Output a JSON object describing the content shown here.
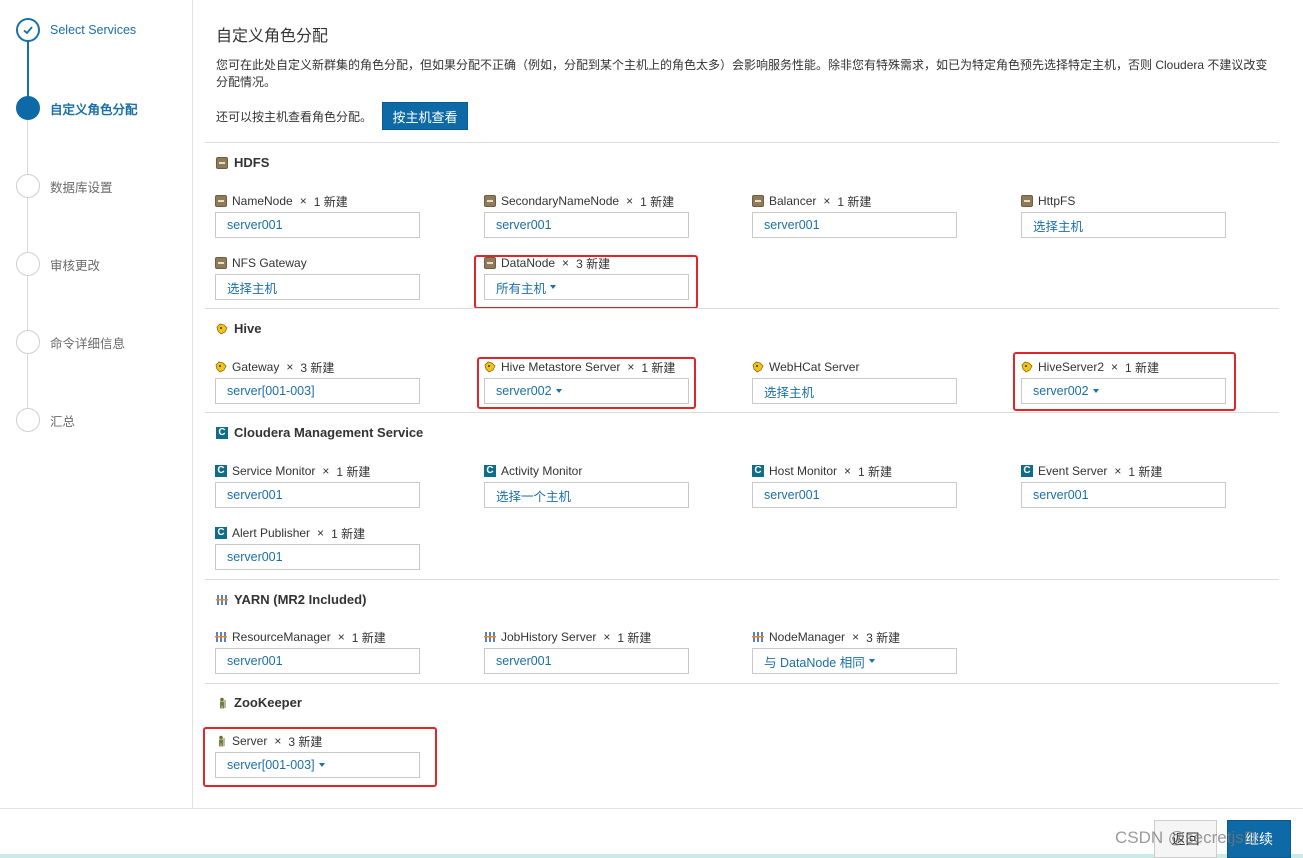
{
  "wizard": {
    "steps": [
      {
        "label": "Select Services",
        "state": "done"
      },
      {
        "label": "自定义角色分配",
        "state": "active"
      },
      {
        "label": "数据库设置",
        "state": "todo"
      },
      {
        "label": "审核更改",
        "state": "todo"
      },
      {
        "label": "命令详细信息",
        "state": "todo"
      },
      {
        "label": "汇总",
        "state": "todo"
      }
    ]
  },
  "page": {
    "title": "自定义角色分配",
    "description": "您可在此处自定义新群集的角色分配，但如果分配不正确（例如，分配到某个主机上的角色太多）会影响服务性能。除非您有特殊需求，如已为特定角色预先选择特定主机，否则 Cloudera 不建议改变分配情况。",
    "host_view_text": "还可以按主机查看角色分配。",
    "host_view_button": "按主机查看"
  },
  "services": {
    "hdfs": {
      "name": "HDFS",
      "roles": [
        {
          "name": "NameNode",
          "x": "×",
          "count": "1 新建",
          "value": "server001"
        },
        {
          "name": "SecondaryNameNode",
          "x": "×",
          "count": "1 新建",
          "value": "server001"
        },
        {
          "name": "Balancer",
          "x": "×",
          "count": "1 新建",
          "value": "server001"
        },
        {
          "name": "HttpFS",
          "x": "",
          "count": "",
          "value": "选择主机"
        },
        {
          "name": "NFS Gateway",
          "x": "",
          "count": "",
          "value": "选择主机"
        },
        {
          "name": "DataNode",
          "x": "×",
          "count": "3 新建",
          "value": "所有主机"
        }
      ]
    },
    "hive": {
      "name": "Hive",
      "roles": [
        {
          "name": "Gateway",
          "x": "×",
          "count": "3 新建",
          "value": "server[001-003]"
        },
        {
          "name": "Hive Metastore Server",
          "x": "×",
          "count": "1 新建",
          "value": "server002"
        },
        {
          "name": "WebHCat Server",
          "x": "",
          "count": "",
          "value": "选择主机"
        },
        {
          "name": "HiveServer2",
          "x": "×",
          "count": "1 新建",
          "value": "server002"
        }
      ]
    },
    "cms": {
      "name": "Cloudera Management Service",
      "icon_letter": "C",
      "roles": [
        {
          "name": "Service Monitor",
          "x": "×",
          "count": "1 新建",
          "value": "server001"
        },
        {
          "name": "Activity Monitor",
          "x": "",
          "count": "",
          "value": "选择一个主机"
        },
        {
          "name": "Host Monitor",
          "x": "×",
          "count": "1 新建",
          "value": "server001"
        },
        {
          "name": "Event Server",
          "x": "×",
          "count": "1 新建",
          "value": "server001"
        },
        {
          "name": "Alert Publisher",
          "x": "×",
          "count": "1 新建",
          "value": "server001"
        }
      ]
    },
    "yarn": {
      "name": "YARN (MR2 Included)",
      "roles": [
        {
          "name": "ResourceManager",
          "x": "×",
          "count": "1 新建",
          "value": "server001"
        },
        {
          "name": "JobHistory Server",
          "x": "×",
          "count": "1 新建",
          "value": "server001"
        },
        {
          "name": "NodeManager",
          "x": "×",
          "count": "3 新建",
          "value": "与 DataNode 相同"
        }
      ]
    },
    "zookeeper": {
      "name": "ZooKeeper",
      "roles": [
        {
          "name": "Server",
          "x": "×",
          "count": "3 新建",
          "value": "server[001-003]"
        }
      ]
    }
  },
  "footer": {
    "back_label": "返回",
    "next_label": "继续",
    "watermark": "CSDN @secretjsD"
  },
  "colors": {
    "accent": "#0e6aa6",
    "link": "#1b6fa8",
    "highlight": "#e0262a"
  }
}
